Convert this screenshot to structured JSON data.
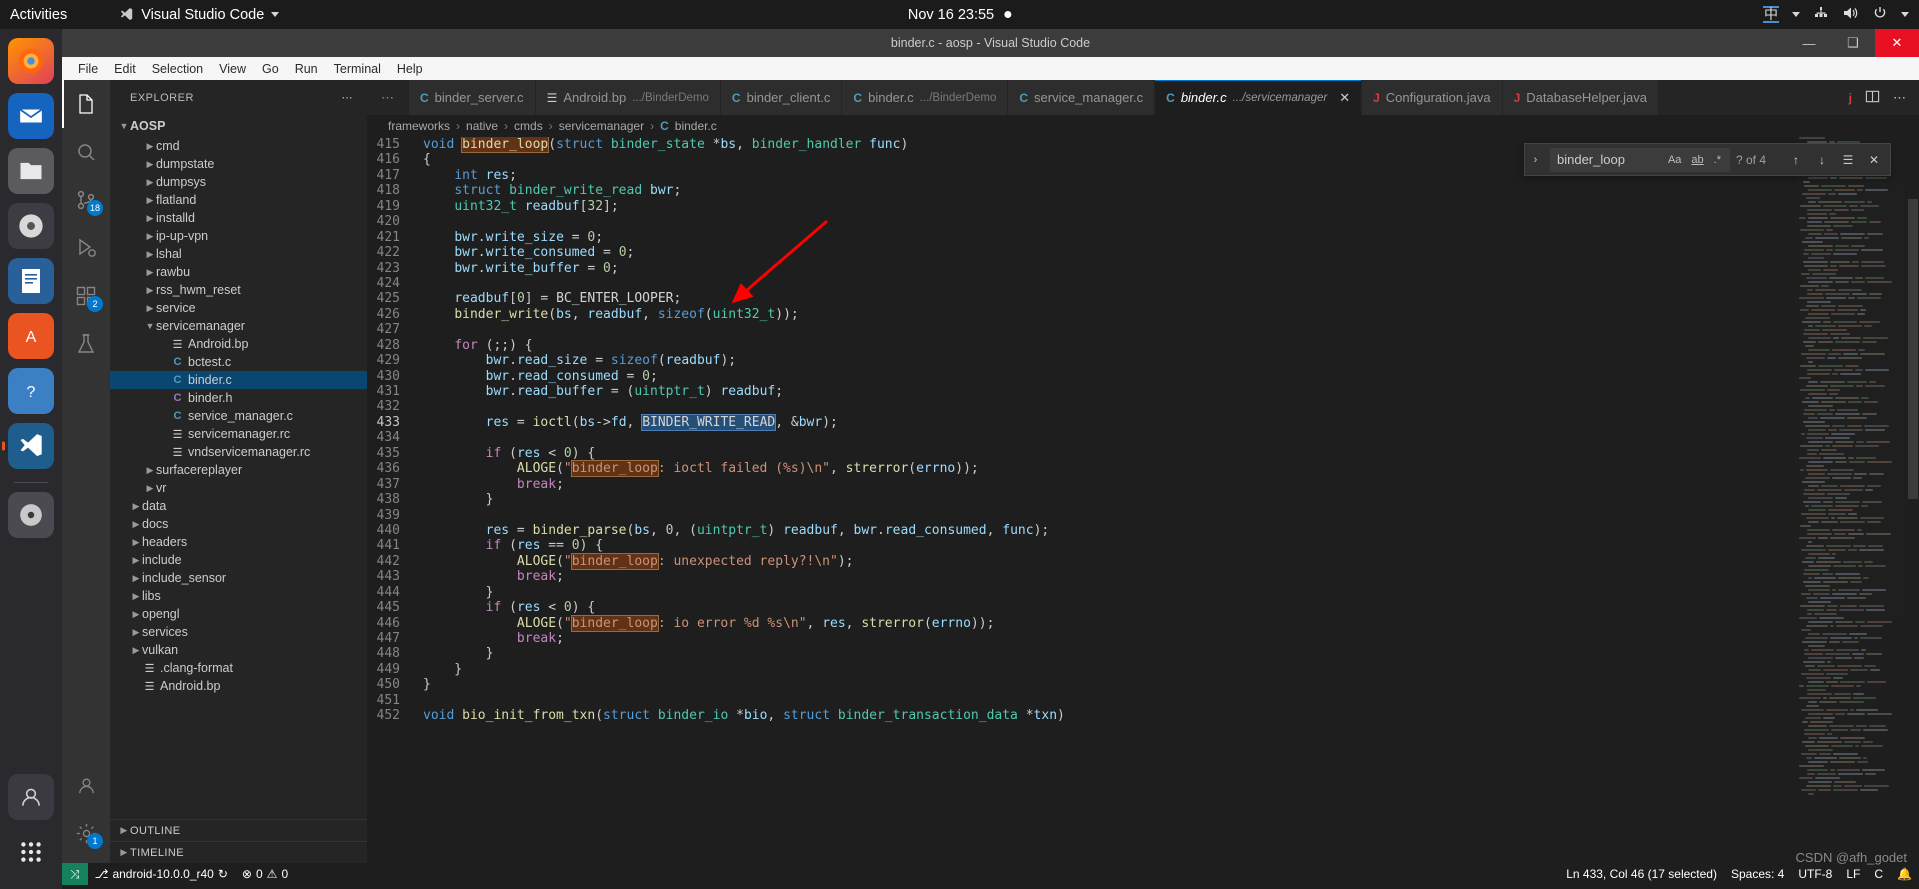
{
  "gnome": {
    "activities": "Activities",
    "app_name": "Visual Studio Code",
    "app_icon": "vscode-icon",
    "clock": "Nov 16  23:55",
    "recording_dot": "record-dot-icon",
    "ime": "中",
    "network_icon": "network-icon",
    "volume_icon": "volume-icon",
    "power_icon": "power-icon"
  },
  "dock": {
    "items": [
      {
        "name": "firefox",
        "glyph": "🦊",
        "badge": null,
        "running": false
      },
      {
        "name": "thunderbird",
        "glyph": "✉",
        "badge": null,
        "running": false
      },
      {
        "name": "files",
        "glyph": "🗁",
        "badge": null,
        "running": false
      },
      {
        "name": "rhythmbox",
        "glyph": "◎",
        "badge": null,
        "running": false
      },
      {
        "name": "libreoffice-writer",
        "glyph": "📄",
        "badge": null,
        "running": false
      },
      {
        "name": "ubuntu-software",
        "glyph": "A",
        "badge": null,
        "running": false
      },
      {
        "name": "help",
        "glyph": "?",
        "badge": null,
        "running": false
      },
      {
        "name": "visual-studio-code",
        "glyph": "⌨",
        "badge": null,
        "running": true
      },
      {
        "name": "dvd-drive",
        "glyph": "●",
        "badge": null,
        "running": false
      }
    ],
    "bottom": [
      {
        "name": "user-account",
        "glyph": "👤"
      },
      {
        "name": "show-applications",
        "glyph": "∷"
      }
    ]
  },
  "window": {
    "title": "binder.c - aosp - Visual Studio Code",
    "minimize": "—",
    "maximize": "❑",
    "close": "✕"
  },
  "menubar": [
    "File",
    "Edit",
    "Selection",
    "View",
    "Go",
    "Run",
    "Terminal",
    "Help"
  ],
  "activitybar": {
    "items": [
      {
        "name": "explorer",
        "glyph": "📄",
        "active": true,
        "badge": null
      },
      {
        "name": "search",
        "glyph": "🔍",
        "active": false,
        "badge": null
      },
      {
        "name": "source-control",
        "glyph": "⎇",
        "active": false,
        "badge": "18"
      },
      {
        "name": "run-and-debug",
        "glyph": "▷",
        "active": false,
        "badge": null
      },
      {
        "name": "extensions",
        "glyph": "⊞",
        "active": false,
        "badge": "2"
      },
      {
        "name": "testing",
        "glyph": "⚗",
        "active": false,
        "badge": null
      }
    ],
    "bottom": [
      {
        "name": "accounts",
        "glyph": "👤"
      },
      {
        "name": "settings-gear",
        "glyph": "⚙",
        "badge": "1"
      }
    ]
  },
  "sidebar": {
    "title": "EXPLORER",
    "more_actions": "⋯",
    "root": "AOSP",
    "outline": "OUTLINE",
    "timeline": "TIMELINE",
    "tree": [
      {
        "label": "cmd",
        "indent": 2,
        "type": "folder",
        "expanded": false
      },
      {
        "label": "dumpstate",
        "indent": 2,
        "type": "folder",
        "expanded": false
      },
      {
        "label": "dumpsys",
        "indent": 2,
        "type": "folder",
        "expanded": false
      },
      {
        "label": "flatland",
        "indent": 2,
        "type": "folder",
        "expanded": false
      },
      {
        "label": "installd",
        "indent": 2,
        "type": "folder",
        "expanded": false
      },
      {
        "label": "ip-up-vpn",
        "indent": 2,
        "type": "folder",
        "expanded": false
      },
      {
        "label": "lshal",
        "indent": 2,
        "type": "folder",
        "expanded": false
      },
      {
        "label": "rawbu",
        "indent": 2,
        "type": "folder",
        "expanded": false
      },
      {
        "label": "rss_hwm_reset",
        "indent": 2,
        "type": "folder",
        "expanded": false
      },
      {
        "label": "service",
        "indent": 2,
        "type": "folder",
        "expanded": false
      },
      {
        "label": "servicemanager",
        "indent": 2,
        "type": "folder",
        "expanded": true
      },
      {
        "label": "Android.bp",
        "indent": 3,
        "type": "bp"
      },
      {
        "label": "bctest.c",
        "indent": 3,
        "type": "c"
      },
      {
        "label": "binder.c",
        "indent": 3,
        "type": "c",
        "selected": true
      },
      {
        "label": "binder.h",
        "indent": 3,
        "type": "h"
      },
      {
        "label": "service_manager.c",
        "indent": 3,
        "type": "c"
      },
      {
        "label": "servicemanager.rc",
        "indent": 3,
        "type": "rc"
      },
      {
        "label": "vndservicemanager.rc",
        "indent": 3,
        "type": "rc"
      },
      {
        "label": "surfacereplayer",
        "indent": 2,
        "type": "folder",
        "expanded": false
      },
      {
        "label": "vr",
        "indent": 2,
        "type": "folder",
        "expanded": false
      },
      {
        "label": "data",
        "indent": 1,
        "type": "folder",
        "expanded": false
      },
      {
        "label": "docs",
        "indent": 1,
        "type": "folder",
        "expanded": false
      },
      {
        "label": "headers",
        "indent": 1,
        "type": "folder",
        "expanded": false
      },
      {
        "label": "include",
        "indent": 1,
        "type": "folder",
        "expanded": false
      },
      {
        "label": "include_sensor",
        "indent": 1,
        "type": "folder",
        "expanded": false
      },
      {
        "label": "libs",
        "indent": 1,
        "type": "folder",
        "expanded": false
      },
      {
        "label": "opengl",
        "indent": 1,
        "type": "folder",
        "expanded": false
      },
      {
        "label": "services",
        "indent": 1,
        "type": "folder",
        "expanded": false
      },
      {
        "label": "vulkan",
        "indent": 1,
        "type": "folder",
        "expanded": false
      },
      {
        "label": ".clang-format",
        "indent": 1,
        "type": "cfg"
      },
      {
        "label": "Android.bp",
        "indent": 1,
        "type": "bp"
      }
    ]
  },
  "tabs": {
    "overflow_left": "⋯",
    "items": [
      {
        "name": "binder_server.c",
        "desc": "",
        "icon": "c",
        "active": false
      },
      {
        "name": "Android.bp",
        "desc": ".../BinderDemo",
        "icon": "bp",
        "active": false
      },
      {
        "name": "binder_client.c",
        "desc": "",
        "icon": "c",
        "active": false
      },
      {
        "name": "binder.c",
        "desc": ".../BinderDemo",
        "icon": "c",
        "active": false
      },
      {
        "name": "service_manager.c",
        "desc": "",
        "icon": "c",
        "active": false
      },
      {
        "name": "binder.c",
        "desc": ".../servicemanager",
        "icon": "c",
        "active": true
      },
      {
        "name": "Configuration.java",
        "desc": "",
        "icon": "j",
        "active": false
      },
      {
        "name": "DatabaseHelper.java",
        "desc": "",
        "icon": "j",
        "active": false
      }
    ],
    "trailing_icon": "j",
    "split_editor": "split-editor-icon",
    "more": "⋯"
  },
  "breadcrumbs": {
    "parts": [
      "frameworks",
      "native",
      "cmds",
      "servicemanager"
    ],
    "file": "binder.c",
    "file_icon": "C"
  },
  "find": {
    "chevron": "›",
    "value": "binder_loop",
    "match_case": "Aa",
    "whole_word": "ab",
    "regex": ".*",
    "count": "? of 4",
    "prev": "↑",
    "next": "↓",
    "selection_only": "☰",
    "close": "✕"
  },
  "code": {
    "first_line": 415,
    "current_line": 433,
    "lines": [
      {
        "n": 415,
        "t": "void binder_loop(struct binder_state *bs, binder_handler func)"
      },
      {
        "n": 416,
        "t": "{"
      },
      {
        "n": 417,
        "t": "    int res;"
      },
      {
        "n": 418,
        "t": "    struct binder_write_read bwr;"
      },
      {
        "n": 419,
        "t": "    uint32_t readbuf[32];"
      },
      {
        "n": 420,
        "t": ""
      },
      {
        "n": 421,
        "t": "    bwr.write_size = 0;"
      },
      {
        "n": 422,
        "t": "    bwr.write_consumed = 0;"
      },
      {
        "n": 423,
        "t": "    bwr.write_buffer = 0;"
      },
      {
        "n": 424,
        "t": ""
      },
      {
        "n": 425,
        "t": "    readbuf[0] = BC_ENTER_LOOPER;"
      },
      {
        "n": 426,
        "t": "    binder_write(bs, readbuf, sizeof(uint32_t));"
      },
      {
        "n": 427,
        "t": ""
      },
      {
        "n": 428,
        "t": "    for (;;) {"
      },
      {
        "n": 429,
        "t": "        bwr.read_size = sizeof(readbuf);"
      },
      {
        "n": 430,
        "t": "        bwr.read_consumed = 0;"
      },
      {
        "n": 431,
        "t": "        bwr.read_buffer = (uintptr_t) readbuf;"
      },
      {
        "n": 432,
        "t": ""
      },
      {
        "n": 433,
        "t": "        res = ioctl(bs->fd, BINDER_WRITE_READ, &bwr);"
      },
      {
        "n": 434,
        "t": ""
      },
      {
        "n": 435,
        "t": "        if (res < 0) {"
      },
      {
        "n": 436,
        "t": "            ALOGE(\"binder_loop: ioctl failed (%s)\\n\", strerror(errno));"
      },
      {
        "n": 437,
        "t": "            break;"
      },
      {
        "n": 438,
        "t": "        }"
      },
      {
        "n": 439,
        "t": ""
      },
      {
        "n": 440,
        "t": "        res = binder_parse(bs, 0, (uintptr_t) readbuf, bwr.read_consumed, func);"
      },
      {
        "n": 441,
        "t": "        if (res == 0) {"
      },
      {
        "n": 442,
        "t": "            ALOGE(\"binder_loop: unexpected reply?!\\n\");"
      },
      {
        "n": 443,
        "t": "            break;"
      },
      {
        "n": 444,
        "t": "        }"
      },
      {
        "n": 445,
        "t": "        if (res < 0) {"
      },
      {
        "n": 446,
        "t": "            ALOGE(\"binder_loop: io error %d %s\\n\", res, strerror(errno));"
      },
      {
        "n": 447,
        "t": "            break;"
      },
      {
        "n": 448,
        "t": "        }"
      },
      {
        "n": 449,
        "t": "    }"
      },
      {
        "n": 450,
        "t": "}"
      },
      {
        "n": 451,
        "t": ""
      },
      {
        "n": 452,
        "t": "void bio_init_from_txn(struct binder_io *bio, struct binder_transaction_data *txn)"
      }
    ],
    "selected_text": "BINDER_WRITE_READ"
  },
  "statusbar": {
    "remote_icon": "⤨",
    "branch_icon": "⎇",
    "branch": "android-10.0.0_r40",
    "sync_icon": "↻",
    "errors_icon": "⊗",
    "errors": "0",
    "warnings_icon": "⚠",
    "warnings": "0",
    "position": "Ln 433, Col 46 (17 selected)",
    "indent": "Spaces: 4",
    "encoding": "UTF-8",
    "eol": "LF",
    "language": "C",
    "bell": "🔔"
  },
  "watermark": "CSDN @afh_godet",
  "colors": {
    "accent": "#007acc",
    "titlebar": "#3c3c3c",
    "sidebar": "#252526",
    "editor": "#1e1e1e",
    "selection": "#264f78",
    "arrow": "#ff0000"
  }
}
